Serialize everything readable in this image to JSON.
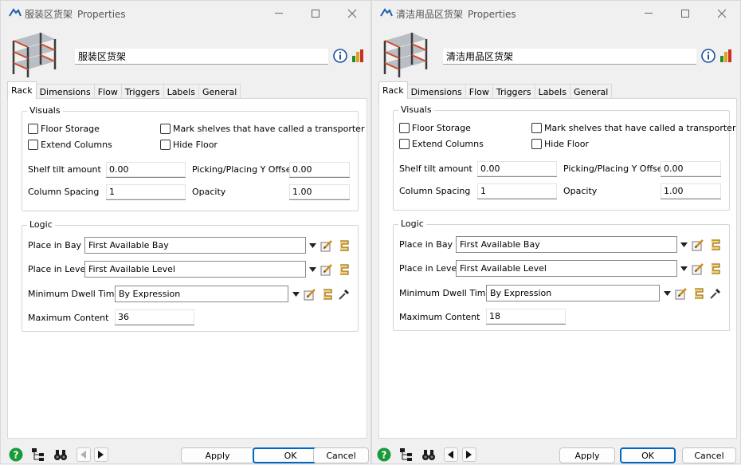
{
  "windows": [
    {
      "title_name": "服装区货架",
      "title_suffix": "Properties",
      "object_name": "服装区货架",
      "tabs": [
        "Rack",
        "Dimensions",
        "Flow",
        "Triggers",
        "Labels",
        "General"
      ],
      "active_tab": "Rack",
      "visuals": {
        "title": "Visuals",
        "floor_storage": "Floor Storage",
        "extend_columns": "Extend Columns",
        "mark_shelves": "Mark shelves that have called a transporter",
        "hide_floor": "Hide Floor",
        "shelf_tilt_label": "Shelf tilt amount",
        "shelf_tilt_value": "0.00",
        "picking_offset_label": "Picking/Placing Y Offset",
        "picking_offset_value": "0.00",
        "column_spacing_label": "Column Spacing",
        "column_spacing_value": "1",
        "opacity_label": "Opacity",
        "opacity_value": "1.00"
      },
      "logic": {
        "title": "Logic",
        "place_in_bay_label": "Place in Bay",
        "place_in_bay_value": "First Available Bay",
        "place_in_level_label": "Place in Level",
        "place_in_level_value": "First Available Level",
        "min_dwell_label": "Minimum Dwell Time",
        "min_dwell_value": "By Expression",
        "max_content_label": "Maximum Content",
        "max_content_value": "36"
      },
      "footer": {
        "apply": "Apply",
        "ok": "OK",
        "cancel": "Cancel"
      }
    },
    {
      "title_name": "清洁用品区货架",
      "title_suffix": "Properties",
      "object_name": "清洁用品区货架",
      "tabs": [
        "Rack",
        "Dimensions",
        "Flow",
        "Triggers",
        "Labels",
        "General"
      ],
      "active_tab": "Rack",
      "visuals": {
        "title": "Visuals",
        "floor_storage": "Floor Storage",
        "extend_columns": "Extend Columns",
        "mark_shelves": "Mark shelves that have called a transporter",
        "hide_floor": "Hide Floor",
        "shelf_tilt_label": "Shelf tilt amount",
        "shelf_tilt_value": "0.00",
        "picking_offset_label": "Picking/Placing Y Offset",
        "picking_offset_value": "0.00",
        "column_spacing_label": "Column Spacing",
        "column_spacing_value": "1",
        "opacity_label": "Opacity",
        "opacity_value": "1.00"
      },
      "logic": {
        "title": "Logic",
        "place_in_bay_label": "Place in Bay",
        "place_in_bay_value": "First Available Bay",
        "place_in_level_label": "Place in Level",
        "place_in_level_value": "First Available Level",
        "min_dwell_label": "Minimum Dwell Time",
        "min_dwell_value": "By Expression",
        "max_content_label": "Maximum Content",
        "max_content_value": "18"
      },
      "footer": {
        "apply": "Apply",
        "ok": "OK",
        "cancel": "Cancel"
      }
    }
  ],
  "icons": {
    "app": "flexsim-logo-icon",
    "rack": "rack-3d-icon",
    "info": "info-icon",
    "stats": "stats-chart-icon",
    "help": "help-icon",
    "tree": "tree-view-icon",
    "find": "binoculars-icon",
    "prev": "arrow-left-icon",
    "next": "arrow-right-icon",
    "edit": "edit-properties-icon",
    "script": "code-script-icon",
    "sampler": "eyedropper-icon"
  },
  "colors": {
    "accent": "#0067c0",
    "help_green": "#1a9b3a",
    "info_blue": "#1a4fa0"
  }
}
